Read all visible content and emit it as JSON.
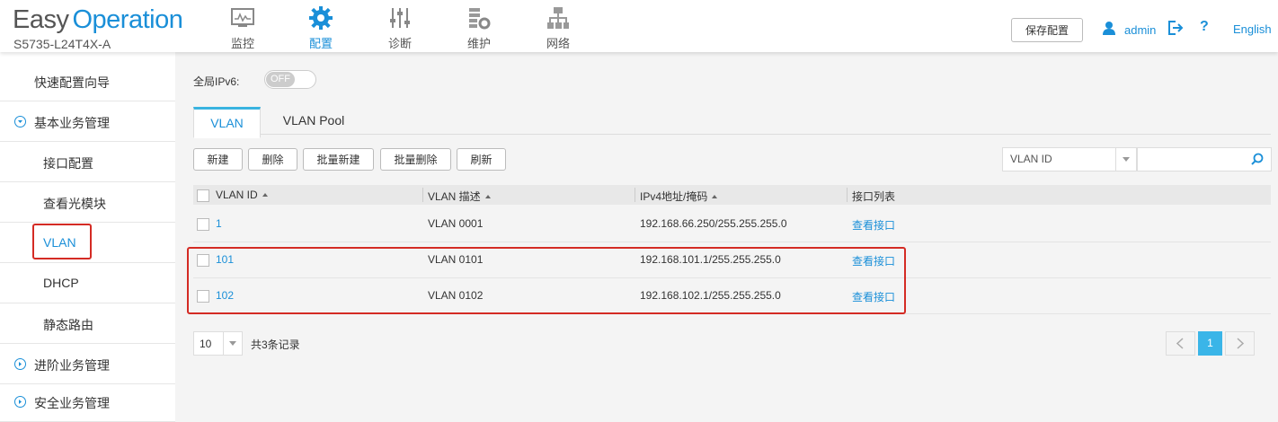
{
  "header": {
    "brand_part1": "Easy",
    "brand_part2": "Operation",
    "model": "S5735-L24T4X-A",
    "nav": [
      {
        "label": "监控",
        "icon": "monitor-icon"
      },
      {
        "label": "配置",
        "icon": "gear-icon"
      },
      {
        "label": "诊断",
        "icon": "sliders-icon"
      },
      {
        "label": "维护",
        "icon": "maintenance-icon"
      },
      {
        "label": "网络",
        "icon": "network-topology-icon"
      }
    ],
    "active_nav": "配置",
    "save_button": "保存配置",
    "user": "admin",
    "help": "?",
    "language": "English"
  },
  "sidebar": {
    "items": [
      {
        "label": "快速配置向导"
      },
      {
        "label": "基本业务管理",
        "icon": "circle-chevron-down-icon"
      },
      {
        "label": "接口配置"
      },
      {
        "label": "查看光模块"
      },
      {
        "label": "VLAN"
      },
      {
        "label": "DHCP"
      },
      {
        "label": "静态路由"
      },
      {
        "label": "进阶业务管理",
        "icon": "circle-chevron-right-icon"
      },
      {
        "label": "安全业务管理",
        "icon": "circle-chevron-right-icon"
      }
    ],
    "active_item": "VLAN"
  },
  "main": {
    "ipv6_label": "全局IPv6:",
    "ipv6_toggle": "OFF",
    "tabs": [
      {
        "label": "VLAN"
      },
      {
        "label": "VLAN Pool"
      }
    ],
    "active_tab": "VLAN",
    "toolbar": {
      "new": "新建",
      "delete": "删除",
      "batch_new": "批量新建",
      "batch_delete": "批量删除",
      "refresh": "刷新"
    },
    "filter_field": "VLAN ID",
    "search_value": "",
    "columns": [
      "VLAN ID",
      "VLAN 描述",
      "IPv4地址/掩码",
      "接口列表"
    ],
    "rows": [
      {
        "id": "1",
        "desc": "VLAN 0001",
        "ip": "192.168.66.250/255.255.255.0",
        "action": "查看接口"
      },
      {
        "id": "101",
        "desc": "VLAN 0101",
        "ip": "192.168.101.1/255.255.255.0",
        "action": "查看接口"
      },
      {
        "id": "102",
        "desc": "VLAN 0102",
        "ip": "192.168.102.1/255.255.255.0",
        "action": "查看接口"
      }
    ],
    "pager": {
      "page_size": "10",
      "total": "共3条记录",
      "current_page": "1"
    }
  },
  "colors": {
    "accent": "#1a8fd8",
    "highlight": "#d42b24",
    "tab_active": "#39b3e0"
  }
}
